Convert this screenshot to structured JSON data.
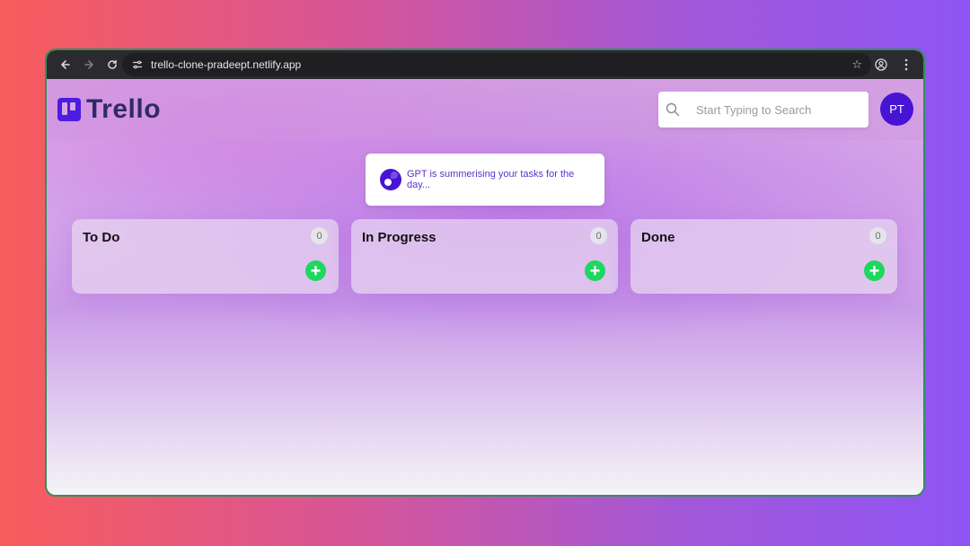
{
  "browser": {
    "url": "trello-clone-pradeept.netlify.app"
  },
  "app": {
    "logo_text": "Trello",
    "search": {
      "placeholder": "Start Typing to Search"
    },
    "avatar_initials": "PT",
    "gpt_message": "GPT is summerising your tasks for the day...",
    "columns": [
      {
        "title": "To Do",
        "count": "0"
      },
      {
        "title": "In Progress",
        "count": "0"
      },
      {
        "title": "Done",
        "count": "0"
      }
    ]
  },
  "colors": {
    "brand": "#4714d6",
    "add_button": "#1ed760",
    "window_border": "#2f8f5e"
  }
}
